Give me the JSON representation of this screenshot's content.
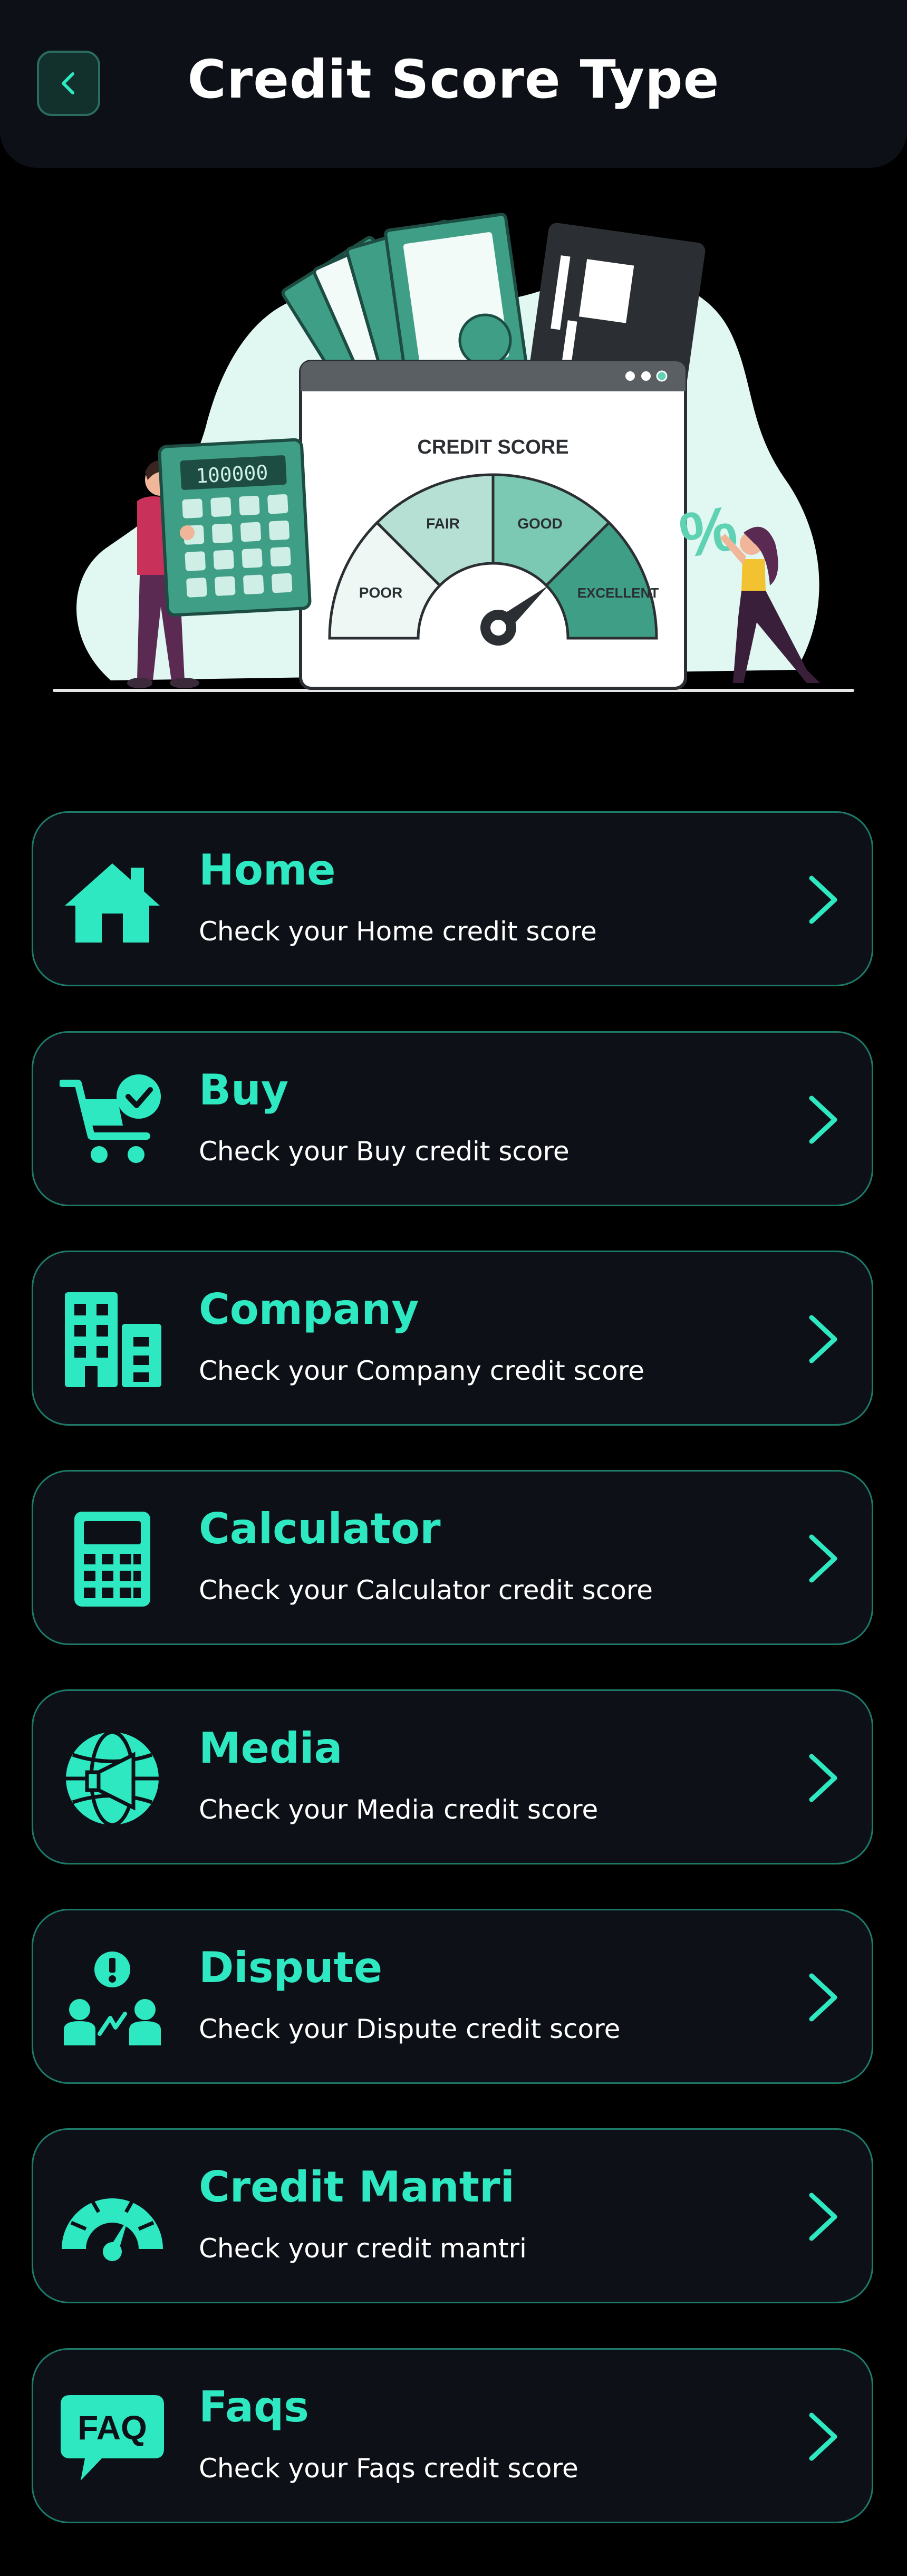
{
  "header": {
    "title": "Credit Score Type",
    "back_icon": "chevron-left-icon"
  },
  "hero": {
    "panel_title": "CREDIT SCORE",
    "gauge_labels": [
      "POOR",
      "FAIR",
      "GOOD",
      "EXCELLENT"
    ],
    "calculator_display": "100000",
    "percent_symbol": "%"
  },
  "colors": {
    "accent": "#2ee8c2",
    "card_bg": "#0d1117",
    "card_border": "#1e7a68",
    "page_bg": "#000000"
  },
  "cards": [
    {
      "title": "Home",
      "subtitle": "Check your Home credit score",
      "icon": "home-icon"
    },
    {
      "title": "Buy",
      "subtitle": "Check your Buy credit score",
      "icon": "cart-check-icon"
    },
    {
      "title": "Company",
      "subtitle": "Check your Company credit score",
      "icon": "building-icon"
    },
    {
      "title": "Calculator",
      "subtitle": "Check your Calculator credit score",
      "icon": "calculator-icon"
    },
    {
      "title": "Media",
      "subtitle": "Check your Media credit score",
      "icon": "globe-megaphone-icon"
    },
    {
      "title": "Dispute",
      "subtitle": "Check your Dispute credit score",
      "icon": "dispute-icon"
    },
    {
      "title": "Credit Mantri",
      "subtitle": "Check your credit mantri",
      "icon": "speedometer-icon"
    },
    {
      "title": "Faqs",
      "subtitle": "Check your Faqs credit score",
      "icon": "faq-bubble-icon"
    }
  ]
}
